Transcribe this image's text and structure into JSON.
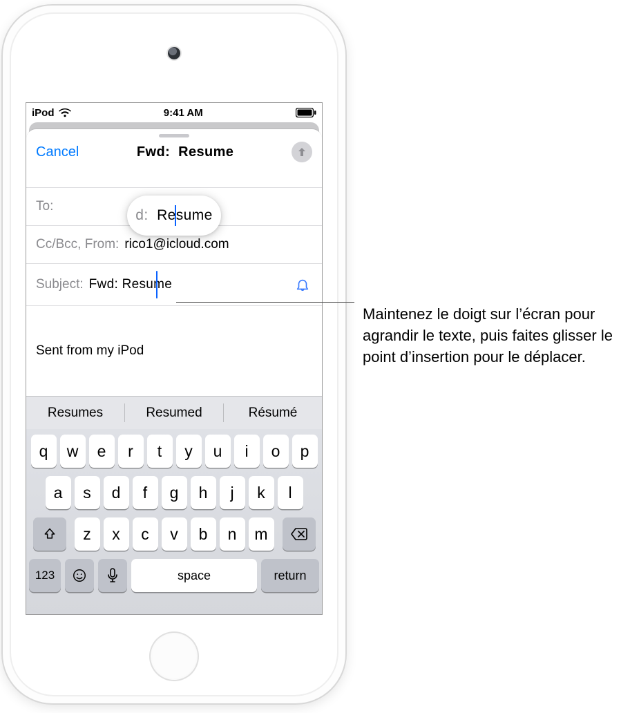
{
  "status": {
    "device_label": "iPod",
    "clock": "9:41 AM"
  },
  "nav": {
    "cancel": "Cancel",
    "title_prefix": "Fwd:",
    "title_rest": "Resume"
  },
  "fields": {
    "to_label": "To:",
    "to_value": "",
    "cc_label": "Cc/Bcc, From:",
    "cc_value": "rico1@icloud.com",
    "subject_label": "Subject:",
    "subject_value": "Fwd:  Resume"
  },
  "body": {
    "signature": "Sent from my iPod"
  },
  "loupe": {
    "left": "d:",
    "right_pre": "Re",
    "right_post": "sume"
  },
  "suggestions": [
    "Resumes",
    "Resumed",
    "Résumé"
  ],
  "keyboard": {
    "row1": [
      "q",
      "w",
      "e",
      "r",
      "t",
      "y",
      "u",
      "i",
      "o",
      "p"
    ],
    "row2": [
      "a",
      "s",
      "d",
      "f",
      "g",
      "h",
      "j",
      "k",
      "l"
    ],
    "row3": [
      "z",
      "x",
      "c",
      "v",
      "b",
      "n",
      "m"
    ],
    "numeric_label": "123",
    "space_label": "space",
    "return_label": "return"
  },
  "callout": {
    "text": "Maintenez le doigt sur l’écran pour agrandir le texte, puis faites glisser le point d’insertion pour le déplacer."
  }
}
